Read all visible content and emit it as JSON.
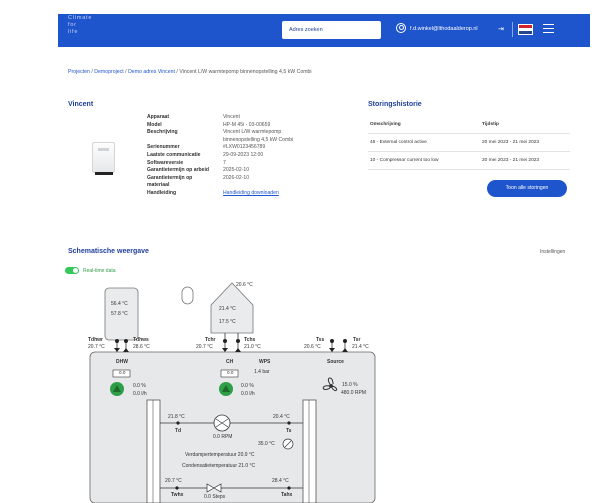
{
  "header": {
    "logo_lines": [
      "Climate",
      "for",
      "life"
    ],
    "search_label": "Adres zoeken",
    "user_email": "f.d.winkel@lthodaalderop.nl",
    "icons": {
      "user": "user-circle-icon",
      "logout": "logout-icon",
      "flag": "flag-nl-icon",
      "menu": "hamburger-menu-icon"
    },
    "brand_color": "#1f55cc"
  },
  "breadcrumb": {
    "items": [
      "Projecten",
      "Demoproject",
      "Demo adres Vincent",
      "Vincent L/W warmtepomp binnenopstelling 4,5 kW Combi"
    ],
    "separator": "/"
  },
  "device": {
    "title": "Vincent",
    "specs": [
      {
        "label": "Apparaat",
        "value": "Vincent"
      },
      {
        "label": "Model",
        "value": "HP-M 45i - 03-00659"
      },
      {
        "label": "Beschrijving",
        "value": "Vincent L/W warmtepomp"
      },
      {
        "label": "",
        "value": "binnenopstelling 4,5 kW Combi"
      },
      {
        "label": "Serienummer",
        "value": "#LXW0123456789"
      },
      {
        "label": "Laatste communicatie",
        "value": "29-09-2023 12:00"
      },
      {
        "label": "Softwareversie",
        "value": "7"
      },
      {
        "label": "Garantietermijn op arbeid",
        "value": "2025-02-10"
      },
      {
        "label": "Garantietermijn op",
        "value": "2026-02-10"
      },
      {
        "label": "materiaal",
        "value": ""
      },
      {
        "label": "Handleiding",
        "value": "Handleiding downloaden"
      }
    ]
  },
  "storingshistorie": {
    "title": "Storingshistorie",
    "columns": [
      "Omschrijving",
      "Tijdstip"
    ],
    "rows": [
      {
        "omschrijving": "46 - External control active",
        "tijdstip": "20 mei 2023 - 21 mei 2023"
      },
      {
        "omschrijving": "10 - Compressor current too low",
        "tijdstip": "20 mei 2023 - 21 mei 2023"
      }
    ],
    "button_label": "Toon alle storingen"
  },
  "schematic": {
    "title": "Schematische weergave",
    "settings_label": "Instellingen",
    "realtime_label": "Real-time data",
    "realtime_on": true,
    "dhw_tank_top": "56.4 °C",
    "dhw_tank_bottom": "57.8 °C",
    "ch_tank_top": "21.4 °C",
    "ch_tank_bottom": "17.5 °C",
    "outdoor_temp": "20.6 °C",
    "tdhwr_label": "Tdhwr",
    "tdhwr_value": "20.7 °C",
    "tdhws_label": "Tdhws",
    "tdhws_value": "28.6 °C",
    "tchr_label": "Tchr",
    "tchr_value": "20.7 °C",
    "tchs_label": "Tchs",
    "tchs_value": "21.0 °C",
    "tss_label": "Tss",
    "tss_value": "20.6 °C",
    "tsr_label": "Tsr",
    "tsr_value": "21.4 °C",
    "dhw_label": "DHW",
    "dhw_box": "0.0",
    "ch_label": "CH",
    "ch_box": "0.0",
    "wps_label": "WPS",
    "wps_value": "1.4 bar",
    "source_label": "Source",
    "dhw_pump_pct": "0.0 %",
    "dhw_pump_flow": "0.0 l/h",
    "ch_pump_pct": "0.0 %",
    "ch_pump_flow": "0.0 l/h",
    "fan_pct": "15.0 %",
    "fan_rpm": "480.0 RPM",
    "td_temp": "21.8 °C",
    "td_label": "Td",
    "ts_temp": "20.4 °C",
    "ts_label": "Ts",
    "comp_rpm": "0.0 RPM",
    "valve_temp": "35.0 °C",
    "evap_label": "Verdampertemperatuur 20.9 °C",
    "cond_label": "Condensatietemperatuur 21.0 °C",
    "twhx_temp": "20.7 °C",
    "twhx_label": "Twhx",
    "tahx_temp": "28.4 °C",
    "tahx_label": "Tahx",
    "eev_steps": "0.0 Steps",
    "pump_color": "#2e9e47"
  }
}
